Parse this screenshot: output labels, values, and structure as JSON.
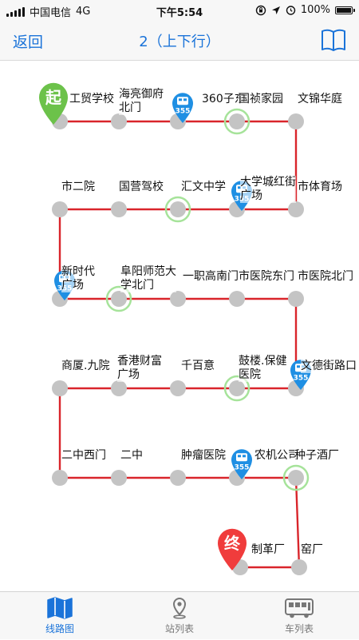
{
  "status_bar": {
    "carrier": "中国电信",
    "network": "4G",
    "time": "下午5:54",
    "battery": "100%"
  },
  "nav": {
    "back_label": "返回",
    "title": "2（上下行）"
  },
  "map": {
    "start_badge": "起",
    "end_badge": "终",
    "bus_number": "355",
    "stops": [
      {
        "name": "工贸学校"
      },
      {
        "name": "海亮御府\n北门"
      },
      {
        "name": "360子东"
      },
      {
        "name": "国祯家园"
      },
      {
        "name": "文锦华庭"
      },
      {
        "name": "市体育场"
      },
      {
        "name": "大学城红街\n广场"
      },
      {
        "name": "汇文中学"
      },
      {
        "name": "国营驾校"
      },
      {
        "name": "市二院"
      },
      {
        "name": "新时代\n广场"
      },
      {
        "name": "阜阳师范大\n学北门"
      },
      {
        "name": "一职高南门"
      },
      {
        "name": "市医院东门"
      },
      {
        "name": "市医院北门"
      },
      {
        "name": "文德街路口"
      },
      {
        "name": "鼓楼.保健\n医院"
      },
      {
        "name": "千百意"
      },
      {
        "name": "香港财富\n广场"
      },
      {
        "name": "商厦.九院"
      },
      {
        "name": "二中西门"
      },
      {
        "name": "二中"
      },
      {
        "name": "肿瘤医院"
      },
      {
        "name": "农机公司"
      },
      {
        "name": "种子酒厂"
      },
      {
        "name": "窑厂"
      },
      {
        "name": "制革厂"
      }
    ]
  },
  "tabs": [
    {
      "label": "线路图"
    },
    {
      "label": "站列表"
    },
    {
      "label": "车列表"
    }
  ],
  "colors": {
    "accent": "#1a73d9",
    "route_line": "#d9252b",
    "stop_dot": "#c4c4c4",
    "stop_highlight_ring": "#a6e39a",
    "bus_pin": "#1f8fe3",
    "start_pin": "#6cc24a",
    "end_pin": "#f03c3c",
    "tab_inactive": "#777777"
  }
}
